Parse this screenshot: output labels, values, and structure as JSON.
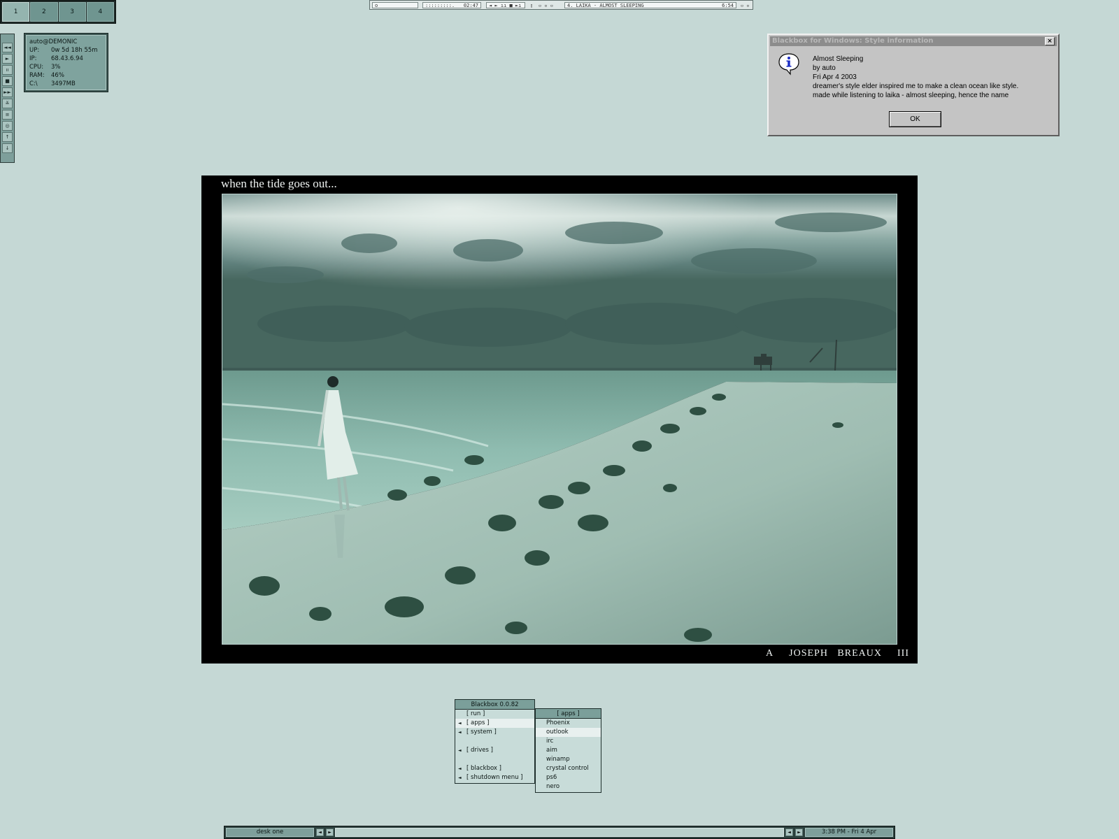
{
  "pager": {
    "workspaces": [
      "1",
      "2",
      "3",
      "4"
    ],
    "active": 0
  },
  "winamp": {
    "mode": "o",
    "vis": ":::::::::.",
    "time": "02:47",
    "controls": "◄ ► ıı ■ ►ı ▲",
    "bar": "▯",
    "opts": "▫ ▫ ▫",
    "track": "4. LAIKA - ALMOST SLEEPING",
    "length": "6:54",
    "win_btns": "▫ ▫"
  },
  "vbar": {
    "buttons": [
      "◄◄",
      "►",
      "ıı",
      "■",
      "►►",
      "≚",
      "≡",
      "◎",
      "↑",
      "↓"
    ]
  },
  "sysmon": {
    "title": "auto@DEMONIC",
    "rows": [
      {
        "label": "UP:",
        "value": "0w 5d 18h 55m"
      },
      {
        "label": "IP:",
        "value": "68.43.6.94"
      },
      {
        "label": "CPU:",
        "value": "3%"
      },
      {
        "label": "RAM:",
        "value": "46%"
      },
      {
        "label": "C:\\",
        "value": "3497MB"
      }
    ]
  },
  "dialog": {
    "title": "Blackbox for Windows: Style information",
    "close": "×",
    "lines": [
      "Almost Sleeping",
      "by auto",
      "Fri Apr 4 2003",
      "dreamer's style elder inspired me to make a clean ocean like style.",
      "made while listening to laika - almost sleeping, hence the name"
    ],
    "ok_label": "OK",
    "icon": "info-icon"
  },
  "poster": {
    "caption": "when the tide goes out...",
    "credit_a": "A",
    "credit_name": "JOSEPH   BREAUX",
    "credit_num": "III"
  },
  "rootmenu": {
    "title": "Blackbox 0.0.82",
    "items": [
      {
        "label": "[ run ]",
        "submenu": false,
        "hl": false
      },
      {
        "label": "[ apps ]",
        "submenu": true,
        "hl": true
      },
      {
        "label": "[ system ]",
        "submenu": true,
        "hl": false
      },
      {
        "label": "",
        "submenu": false,
        "hl": false
      },
      {
        "label": "[ drives ]",
        "submenu": true,
        "hl": false
      },
      {
        "label": "",
        "submenu": false,
        "hl": false
      },
      {
        "label": "[ blackbox ]",
        "submenu": true,
        "hl": false
      },
      {
        "label": "[ shutdown menu ]",
        "submenu": true,
        "hl": false
      }
    ]
  },
  "appsmenu": {
    "title": "[ apps ]",
    "items": [
      "Phoenix",
      "outlook",
      "irc",
      "aim",
      "winamp",
      "crystal control",
      "ps6",
      "nero"
    ],
    "highlight": 1
  },
  "taskbar": {
    "workspace": "desk one",
    "clock": "3:38 PM - Fri 4 Apr",
    "prev": "◄",
    "next": "►"
  },
  "colors": {
    "desktop": "#c5d8d5",
    "accent": "#7b9f9a",
    "dark": "#1e2e2c"
  }
}
